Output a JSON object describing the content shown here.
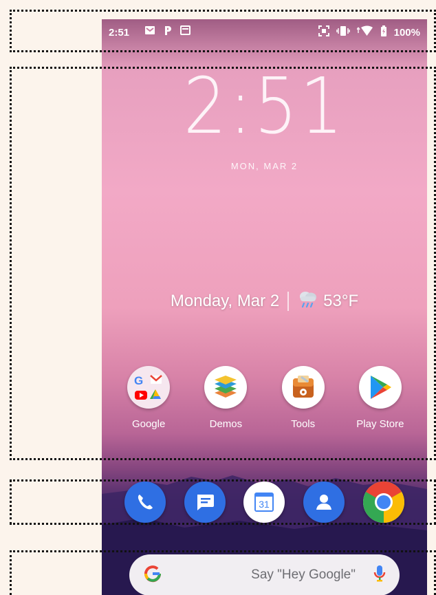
{
  "status_bar": {
    "time": "2:51",
    "battery": "100%"
  },
  "clock": {
    "time": "2:51",
    "date": "MON, MAR 2"
  },
  "glance": {
    "date": "Monday, Mar 2",
    "temperature": "53°F"
  },
  "apps": [
    {
      "label": "Google",
      "icon": "google-folder-icon"
    },
    {
      "label": "Demos",
      "icon": "demos-icon"
    },
    {
      "label": "Tools",
      "icon": "tools-icon"
    },
    {
      "label": "Play Store",
      "icon": "play-store-icon"
    }
  ],
  "dock": [
    {
      "icon": "phone-icon"
    },
    {
      "icon": "messages-icon"
    },
    {
      "icon": "calendar-icon",
      "text": "31"
    },
    {
      "icon": "contacts-icon"
    },
    {
      "icon": "chrome-icon"
    }
  ],
  "search": {
    "placeholder": "Say \"Hey Google\""
  },
  "colors": {
    "google_blue": "#4285F4",
    "google_red": "#EA4335",
    "google_yellow": "#FBBC05",
    "google_green": "#34A853",
    "dock_blue": "#2f6fe3"
  }
}
